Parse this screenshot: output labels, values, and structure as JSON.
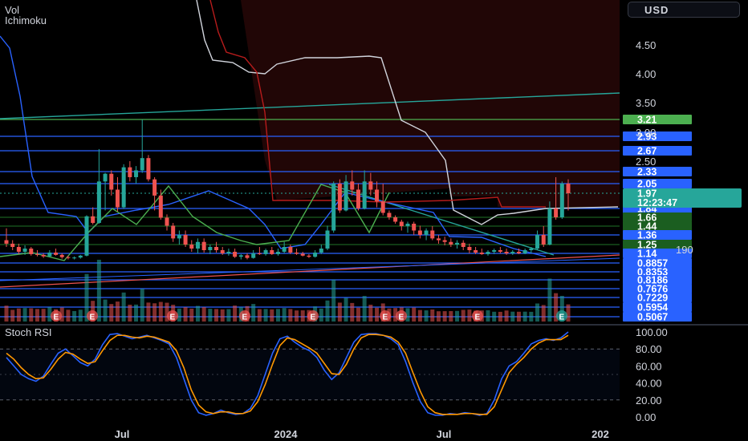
{
  "legend": {
    "vol": "Vol",
    "ichimoku": "Ichimoku",
    "stoch_rsi": "Stoch RSI"
  },
  "currency": "USD",
  "colors": {
    "up": "#26a69a",
    "down": "#ef5350",
    "level": "#2962ff",
    "green_line": "#4caf50",
    "kijun": "#b71c1c",
    "tenkan": "#ffffff"
  },
  "chart_data": [
    {
      "type": "candlestick",
      "price_ticks": [
        "4.50",
        "4.00",
        "3.50",
        "3.00",
        "2.50"
      ],
      "x_ticks": [
        "Jul",
        "2024",
        "Jul",
        "202"
      ],
      "horizontal_levels": [
        {
          "label": "3.21",
          "color": "#4caf50"
        },
        {
          "label": "2.93",
          "color": "#2962ff"
        },
        {
          "label": "2.67",
          "color": "#2962ff"
        },
        {
          "label": "2.33",
          "color": "#2962ff"
        },
        {
          "label": "2.05",
          "color": "#2962ff"
        },
        {
          "label": "1.84",
          "color": "#2962ff"
        },
        {
          "label": "1.66",
          "color": "#1b5e20"
        },
        {
          "label": "1.44",
          "color": "#1b5e20"
        },
        {
          "label": "1.36",
          "color": "#2962ff"
        },
        {
          "label": "1.25",
          "color": "#1b5e20"
        },
        {
          "label": "1.14",
          "color": "#2962ff"
        },
        {
          "label": "0.8857",
          "color": "#2962ff"
        },
        {
          "label": "0.8353",
          "color": "#2962ff"
        },
        {
          "label": "0.8186",
          "color": "#2962ff"
        },
        {
          "label": "0.7676",
          "color": "#2962ff"
        },
        {
          "label": "0.7229",
          "color": "#2962ff"
        },
        {
          "label": "0.5954",
          "color": "#2962ff"
        },
        {
          "label": "0.5067",
          "color": "#2962ff"
        }
      ],
      "current_price": {
        "label": "1.97",
        "countdown": "12:23:47",
        "color": "#26a69a"
      },
      "earnings_marker": "E",
      "candles_ohlc": [
        [
          1.3,
          1.42,
          1.22,
          1.26
        ],
        [
          1.26,
          1.3,
          1.18,
          1.22
        ],
        [
          1.22,
          1.26,
          1.12,
          1.16
        ],
        [
          1.16,
          1.24,
          1.1,
          1.2
        ],
        [
          1.2,
          1.22,
          1.08,
          1.12
        ],
        [
          1.12,
          1.18,
          1.06,
          1.1
        ],
        [
          1.1,
          1.14,
          1.02,
          1.06
        ],
        [
          1.06,
          1.18,
          1.04,
          1.15
        ],
        [
          1.15,
          1.2,
          1.08,
          1.1
        ],
        [
          1.1,
          1.14,
          1.0,
          1.04
        ],
        [
          1.04,
          1.08,
          0.98,
          1.02
        ],
        [
          1.02,
          1.06,
          0.98,
          1.03
        ],
        [
          1.03,
          1.1,
          1.0,
          1.08
        ],
        [
          1.08,
          1.7,
          1.06,
          1.68
        ],
        [
          1.68,
          1.85,
          1.48,
          1.52
        ],
        [
          1.52,
          2.7,
          1.5,
          2.1
        ],
        [
          2.1,
          2.3,
          1.8,
          2.28
        ],
        [
          2.28,
          2.35,
          1.95,
          2.0
        ],
        [
          2.0,
          2.2,
          1.78,
          1.85
        ],
        [
          1.85,
          2.45,
          1.83,
          2.4
        ],
        [
          2.4,
          2.5,
          2.1,
          2.2
        ],
        [
          2.2,
          2.42,
          2.05,
          2.35
        ],
        [
          2.35,
          3.21,
          2.3,
          2.55
        ],
        [
          2.55,
          2.6,
          2.1,
          2.15
        ],
        [
          2.15,
          2.2,
          1.8,
          1.95
        ],
        [
          1.95,
          2.0,
          1.6,
          1.65
        ],
        [
          1.65,
          1.72,
          1.4,
          1.45
        ],
        [
          1.45,
          1.52,
          1.28,
          1.32
        ],
        [
          1.32,
          1.4,
          1.25,
          1.36
        ],
        [
          1.36,
          1.4,
          1.22,
          1.25
        ],
        [
          1.25,
          1.3,
          1.16,
          1.2
        ],
        [
          1.2,
          1.32,
          1.14,
          1.28
        ],
        [
          1.28,
          1.32,
          1.15,
          1.18
        ],
        [
          1.18,
          1.25,
          1.12,
          1.22
        ],
        [
          1.22,
          1.28,
          1.15,
          1.18
        ],
        [
          1.18,
          1.22,
          1.1,
          1.14
        ],
        [
          1.14,
          1.2,
          1.08,
          1.16
        ],
        [
          1.16,
          1.2,
          1.02,
          1.05
        ],
        [
          1.05,
          1.12,
          0.98,
          1.09
        ],
        [
          1.09,
          1.14,
          0.98,
          1.02
        ],
        [
          1.02,
          1.18,
          1.0,
          1.14
        ],
        [
          1.14,
          1.22,
          1.1,
          1.12
        ],
        [
          1.12,
          1.2,
          1.08,
          1.18
        ],
        [
          1.18,
          1.22,
          1.1,
          1.12
        ],
        [
          1.12,
          1.2,
          1.08,
          1.16
        ],
        [
          1.16,
          1.28,
          1.14,
          1.22
        ],
        [
          1.22,
          1.25,
          1.12,
          1.15
        ],
        [
          1.15,
          1.2,
          1.1,
          1.13
        ],
        [
          1.13,
          1.16,
          1.06,
          1.08
        ],
        [
          1.08,
          1.12,
          1.02,
          1.05
        ],
        [
          1.05,
          1.18,
          1.03,
          1.15
        ],
        [
          1.15,
          1.25,
          1.12,
          1.2
        ],
        [
          1.2,
          1.45,
          1.18,
          1.4
        ],
        [
          1.4,
          2.1,
          1.38,
          2.05
        ],
        [
          2.05,
          2.15,
          1.75,
          1.8
        ],
        [
          1.8,
          2.25,
          1.78,
          2.1
        ],
        [
          2.1,
          2.35,
          1.95,
          2.0
        ],
        [
          2.0,
          2.05,
          1.8,
          1.84
        ],
        [
          1.84,
          2.35,
          1.82,
          2.1
        ],
        [
          2.1,
          2.3,
          1.95,
          2.0
        ],
        [
          2.0,
          2.1,
          1.85,
          1.9
        ],
        [
          1.9,
          2.05,
          1.7,
          1.75
        ],
        [
          1.75,
          1.8,
          1.6,
          1.66
        ],
        [
          1.66,
          1.7,
          1.5,
          1.55
        ],
        [
          1.55,
          1.6,
          1.4,
          1.44
        ],
        [
          1.44,
          1.55,
          1.38,
          1.5
        ],
        [
          1.5,
          1.55,
          1.36,
          1.4
        ],
        [
          1.4,
          1.45,
          1.32,
          1.36
        ],
        [
          1.36,
          1.42,
          1.3,
          1.4
        ],
        [
          1.4,
          1.44,
          1.3,
          1.32
        ],
        [
          1.32,
          1.36,
          1.26,
          1.3
        ],
        [
          1.3,
          1.34,
          1.24,
          1.28
        ],
        [
          1.28,
          1.32,
          1.22,
          1.25
        ],
        [
          1.25,
          1.3,
          1.2,
          1.27
        ],
        [
          1.27,
          1.3,
          1.18,
          1.22
        ],
        [
          1.22,
          1.26,
          1.14,
          1.18
        ],
        [
          1.18,
          1.22,
          1.12,
          1.15
        ],
        [
          1.15,
          1.2,
          1.1,
          1.12
        ],
        [
          1.12,
          1.18,
          1.08,
          1.16
        ],
        [
          1.16,
          1.2,
          1.12,
          1.18
        ],
        [
          1.18,
          1.22,
          1.14,
          1.16
        ],
        [
          1.16,
          1.2,
          1.1,
          1.14
        ],
        [
          1.14,
          1.18,
          1.1,
          1.16
        ],
        [
          1.16,
          1.2,
          1.12,
          1.14
        ],
        [
          1.14,
          1.2,
          1.12,
          1.18
        ],
        [
          1.18,
          1.22,
          1.14,
          1.2
        ],
        [
          1.2,
          1.4,
          1.18,
          1.36
        ],
        [
          1.36,
          1.44,
          1.22,
          1.25
        ],
        [
          1.25,
          1.9,
          1.24,
          1.84
        ],
        [
          1.84,
          2.2,
          1.6,
          1.66
        ],
        [
          1.66,
          2.1,
          1.62,
          2.05
        ],
        [
          2.05,
          2.15,
          1.8,
          1.97
        ]
      ],
      "volume_ticks": [
        "190"
      ]
    },
    {
      "type": "line",
      "title": "Stoch RSI",
      "y_ticks": [
        "100.00",
        "80.00",
        "60.00",
        "40.00",
        "20.00",
        "0.00"
      ],
      "ylim": [
        0,
        100
      ],
      "series": [
        {
          "values": [
            70,
            60,
            50,
            45,
            42,
            48,
            62,
            75,
            80,
            72,
            64,
            60,
            68,
            85,
            97,
            98,
            95,
            92,
            94,
            96,
            93,
            90,
            86,
            70,
            45,
            20,
            5,
            2,
            4,
            8,
            5,
            3,
            4,
            10,
            25,
            50,
            75,
            92,
            95,
            88,
            82,
            78,
            70,
            55,
            44,
            52,
            70,
            88,
            97,
            98,
            98,
            96,
            92,
            85,
            65,
            40,
            18,
            5,
            2,
            2,
            4,
            3,
            5,
            4,
            2,
            4,
            20,
            45,
            60,
            65,
            75,
            86,
            90,
            92,
            90,
            93,
            100
          ],
          "color": "#2962ff"
        },
        {
          "values": [
            75,
            68,
            58,
            50,
            45,
            46,
            56,
            68,
            76,
            74,
            68,
            63,
            65,
            78,
            90,
            96,
            96,
            94,
            93,
            95,
            94,
            91,
            88,
            78,
            58,
            32,
            14,
            6,
            4,
            6,
            6,
            4,
            4,
            7,
            18,
            38,
            62,
            84,
            93,
            91,
            86,
            81,
            75,
            63,
            51,
            50,
            62,
            80,
            93,
            97,
            97,
            96,
            94,
            88,
            75,
            52,
            30,
            12,
            5,
            3,
            3,
            3,
            4,
            4,
            3,
            3,
            12,
            32,
            52,
            62,
            70,
            80,
            87,
            91,
            91,
            91,
            96
          ],
          "color": "#ff9800"
        }
      ]
    }
  ]
}
